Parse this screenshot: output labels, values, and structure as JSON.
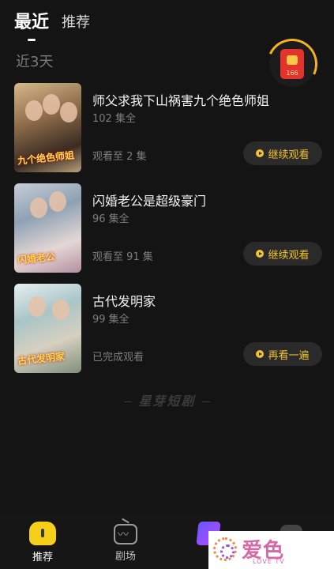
{
  "header": {
    "tabs": [
      {
        "label": "最近",
        "active": true
      },
      {
        "label": "推荐",
        "active": false
      }
    ]
  },
  "section": {
    "title": "近3天"
  },
  "reward": {
    "count": "166",
    "icon": "red-packet-icon"
  },
  "dramas": [
    {
      "title": "师父求我下山祸害九个绝色师姐",
      "episodes": "102 集全",
      "progress": "观看至 2 集",
      "action": "继续观看",
      "poster_text": "九个绝色师姐"
    },
    {
      "title": "闪婚老公是超级豪门",
      "episodes": "96 集全",
      "progress": "观看至 91 集",
      "action": "继续观看",
      "poster_text": "闪婚老公"
    },
    {
      "title": "古代发明家",
      "episodes": "99 集全",
      "progress": "已完成观看",
      "action": "再看一遍",
      "poster_text": "古代发明家"
    }
  ],
  "footer": {
    "brand": "星芽短剧"
  },
  "nav": {
    "items": [
      {
        "label": "推荐",
        "icon": "home-icon",
        "active": true
      },
      {
        "label": "剧场",
        "icon": "tv-icon",
        "active": false
      }
    ]
  },
  "watermark": {
    "text": "爱色",
    "sub": "LOVE TV"
  },
  "colors": {
    "accent": "#f2c230",
    "background": "#141414",
    "redpacket": "#e4332c"
  }
}
